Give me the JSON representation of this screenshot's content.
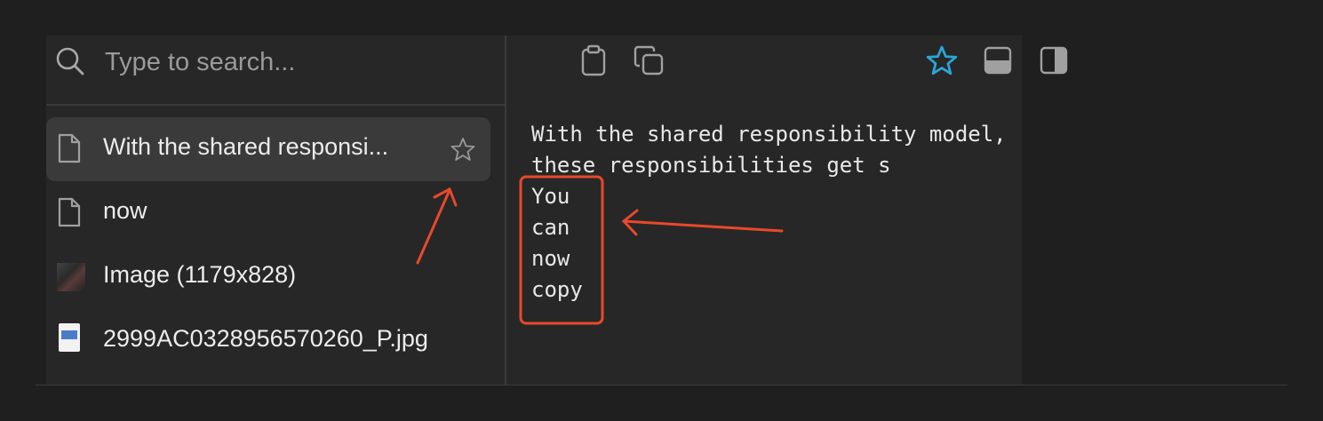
{
  "search": {
    "placeholder": "Type to search...",
    "icon": "search-icon"
  },
  "list": {
    "items": [
      {
        "label": "With the shared responsi...",
        "icon": "document-icon",
        "selected": true,
        "starred": false
      },
      {
        "label": "now",
        "icon": "document-icon",
        "selected": false
      },
      {
        "label": "Image (1179x828)",
        "icon": "image-thumbnail-icon",
        "selected": false
      },
      {
        "label": "2999AC0328956570260_P.jpg",
        "icon": "jpg-file-icon",
        "selected": false
      }
    ]
  },
  "toolbar": {
    "icons": [
      "clipboard-icon",
      "copy-icon",
      "star-icon",
      "layout-bottom-panel-icon",
      "layout-side-panel-icon"
    ],
    "star_active": true
  },
  "content": {
    "lines": [
      "With the shared responsibility model,",
      "these responsibilities get s",
      "You",
      "can",
      "now",
      "copy"
    ]
  },
  "colors": {
    "background": "#1f1f1f",
    "panel": "#272727",
    "selected_item": "#3a3a3a",
    "accent_star": "#2aa6d6",
    "annotation": "#e8492b",
    "text": "#e8e8e8"
  }
}
